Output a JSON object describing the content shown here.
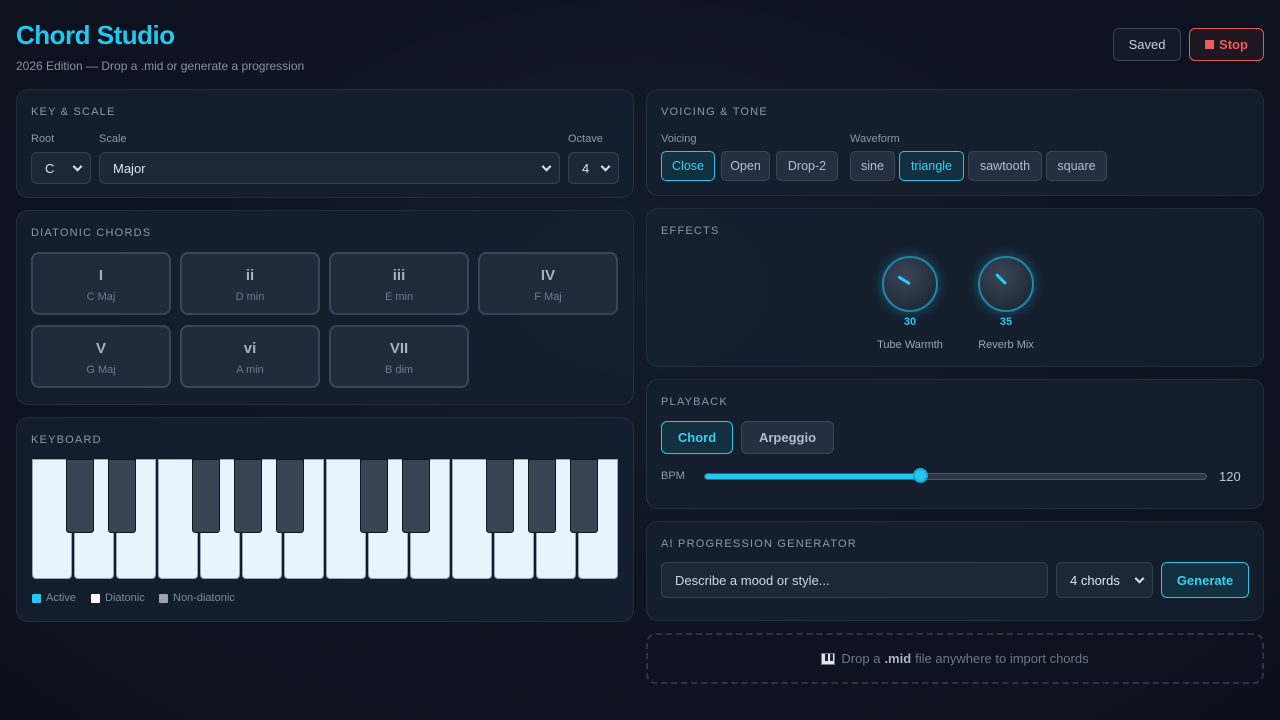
{
  "app": {
    "title": "Chord Studio",
    "subtitle": "2026 Edition — Drop a .mid or generate a progression",
    "saved_label": "Saved",
    "stop_label": "Stop"
  },
  "key_scale": {
    "title": "KEY & SCALE",
    "root_label": "Root",
    "root_value": "C",
    "scale_label": "Scale",
    "scale_value": "Major",
    "octave_label": "Octave",
    "octave_value": "4"
  },
  "diatonic": {
    "title": "DIATONIC CHORDS",
    "chords": [
      {
        "roman": "I",
        "name": "C Maj"
      },
      {
        "roman": "ii",
        "name": "D min"
      },
      {
        "roman": "iii",
        "name": "E min"
      },
      {
        "roman": "IV",
        "name": "F Maj"
      },
      {
        "roman": "V",
        "name": "G Maj"
      },
      {
        "roman": "vi",
        "name": "A min"
      },
      {
        "roman": "VII",
        "name": "B dim"
      }
    ]
  },
  "keyboard": {
    "title": "KEYBOARD",
    "legend": [
      "Active",
      "Diatonic",
      "Non-diatonic"
    ],
    "legend_colors": [
      "#22c8f0",
      "#ffffff",
      "#9aa3ae"
    ]
  },
  "voicing": {
    "title": "VOICING & TONE",
    "voicing_label": "Voicing",
    "voicing_options": [
      "Close",
      "Open",
      "Drop-2"
    ],
    "voicing_selected": "Close",
    "waveform_label": "Waveform",
    "waveform_options": [
      "sine",
      "triangle",
      "sawtooth",
      "square"
    ],
    "waveform_selected": "triangle"
  },
  "effects": {
    "title": "EFFECTS",
    "knobs": [
      {
        "label": "Tube Warmth",
        "value": "30"
      },
      {
        "label": "Reverb Mix",
        "value": "35"
      }
    ]
  },
  "playback": {
    "title": "PLAYBACK",
    "modes": [
      "Chord",
      "Arpeggio"
    ],
    "mode_selected": "Chord",
    "bpm_label": "BPM",
    "bpm_value": "120",
    "bpm_fraction": 0.43
  },
  "ai": {
    "title": "AI PROGRESSION GENERATOR",
    "input_placeholder": "Describe a mood or style...",
    "count_value": "4 chords",
    "generate_label": "Generate"
  },
  "dropzone": {
    "text_before": "Drop a",
    "text_bold": ".mid",
    "text_after": "file anywhere to import chords"
  },
  "accent_color": "#22c8f0",
  "stop_color": "#ef5b5b"
}
